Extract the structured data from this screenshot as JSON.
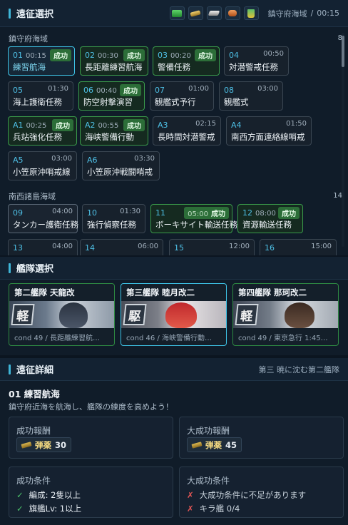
{
  "expedition_panel": {
    "title": "遠征選択",
    "resource_icons": [
      {
        "name": "fuel-icon",
        "color": "#3db24c"
      },
      {
        "name": "ammo-icon",
        "color": "#d9b34c"
      },
      {
        "name": "steel-icon",
        "color": "#c8c8c8"
      },
      {
        "name": "bauxite-icon",
        "color": "#d9783a"
      },
      {
        "name": "bucket-icon",
        "color": "#e2c33c"
      }
    ],
    "area_label": "鎮守府海域",
    "separator": "/",
    "total_time": "00:15",
    "sections": [
      {
        "name": "鎮守府海域",
        "count": "8",
        "missions": [
          {
            "id": "01",
            "time": "00:15",
            "name": "練習航海",
            "status": "成功",
            "state": "selected"
          },
          {
            "id": "02",
            "time": "00:30",
            "name": "長距離練習航海",
            "status": "成功",
            "state": "success"
          },
          {
            "id": "03",
            "time": "00:20",
            "name": "警備任務",
            "status": "成功",
            "state": "success"
          },
          {
            "id": "04",
            "time": "00:50",
            "name": "対潜警戒任務",
            "status": "",
            "state": "normal"
          },
          {
            "id": "05",
            "time": "01:30",
            "name": "海上護衛任務",
            "status": "",
            "state": "normal"
          },
          {
            "id": "06",
            "time": "00:40",
            "name": "防空射撃演習",
            "status": "成功",
            "state": "success"
          },
          {
            "id": "07",
            "time": "01:00",
            "name": "観艦式予行",
            "status": "",
            "state": "normal"
          },
          {
            "id": "08",
            "time": "03:00",
            "name": "観艦式",
            "status": "",
            "state": "normal"
          },
          {
            "id": "A1",
            "time": "00:25",
            "name": "兵站強化任務",
            "status": "成功",
            "state": "success"
          },
          {
            "id": "A2",
            "time": "00:55",
            "name": "海峡警備行動",
            "status": "成功",
            "state": "success"
          },
          {
            "id": "A3",
            "time": "02:15",
            "name": "長時間対潜警戒",
            "status": "",
            "state": "normal"
          },
          {
            "id": "A4",
            "time": "01:50",
            "name": "南西方面連絡線哨戒",
            "status": "",
            "state": "normal"
          },
          {
            "id": "A5",
            "time": "03:00",
            "name": "小笠原沖哨戒線",
            "status": "",
            "state": "normal"
          },
          {
            "id": "A6",
            "time": "03:30",
            "name": "小笠原沖戦闘哨戒",
            "status": "",
            "state": "normal"
          }
        ]
      },
      {
        "name": "南西諸島海域",
        "count": "14",
        "missions": [
          {
            "id": "09",
            "time": "04:00",
            "name": "タンカー護衛任務",
            "status": "",
            "state": "normal"
          },
          {
            "id": "10",
            "time": "01:30",
            "name": "強行偵察任務",
            "status": "",
            "state": "normal"
          },
          {
            "id": "11",
            "time": "05:00",
            "name": "ボーキサイト輸送任務",
            "status": "成功",
            "state": "success"
          },
          {
            "id": "12",
            "time": "08:00",
            "name": "資源輸送任務",
            "status": "成功",
            "state": "success"
          },
          {
            "id": "13",
            "time": "04:00",
            "name": "",
            "status": "",
            "state": "normal"
          },
          {
            "id": "14",
            "time": "06:00",
            "name": "",
            "status": "",
            "state": "normal"
          },
          {
            "id": "15",
            "time": "12:00",
            "name": "",
            "status": "",
            "state": "normal"
          },
          {
            "id": "16",
            "time": "15:00",
            "name": "",
            "status": "",
            "state": "normal"
          }
        ]
      }
    ]
  },
  "fleet_panel": {
    "title": "艦隊選択",
    "fleets": [
      {
        "name": "第二艦隊 天龍改",
        "cond_label": "cond",
        "cond": "49",
        "separator": "/",
        "status": "長距離練習航…",
        "badge": "軽",
        "state": "success"
      },
      {
        "name": "第三艦隊 睦月改二",
        "cond_label": "cond",
        "cond": "46",
        "separator": "/",
        "status": "海峡警備行動…",
        "badge": "駆",
        "state": "selected"
      },
      {
        "name": "第四艦隊 那珂改二",
        "cond_label": "cond",
        "cond": "49",
        "separator": "/",
        "status": "東京急行 1:45…",
        "badge": "軽",
        "state": "success"
      }
    ]
  },
  "detail_panel": {
    "title": "遠征詳細",
    "right_note": "第三 暁に沈む第二艦隊",
    "mission_title": "01 練習航海",
    "description": "鎮守府近海を航海し、艦隊の練度を高めよう！",
    "success_reward": {
      "label": "成功報酬",
      "item": "弾薬",
      "amount": "30"
    },
    "great_reward": {
      "label": "大成功報酬",
      "item": "弾薬",
      "amount": "45"
    },
    "success_conditions": {
      "label": "成功条件",
      "items": [
        {
          "mark": "✓",
          "text": "編成: 2隻以上"
        },
        {
          "mark": "✓",
          "text": "旗艦Lv: 1以上"
        }
      ]
    },
    "great_conditions": {
      "label": "大成功条件",
      "items": [
        {
          "mark": "✗",
          "text": "大成功条件に不足があります"
        },
        {
          "mark": "✗",
          "text": "キラ艦 0/4"
        }
      ]
    }
  }
}
